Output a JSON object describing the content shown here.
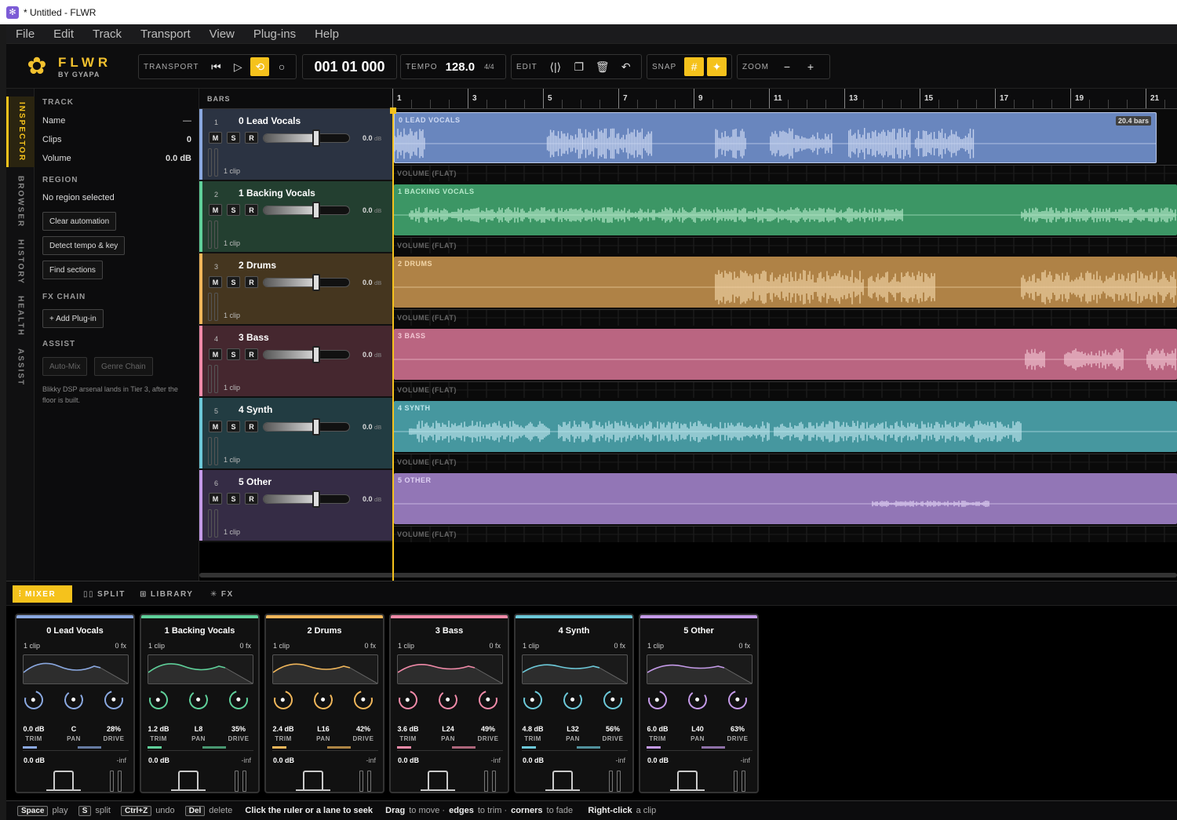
{
  "window": {
    "title": "* Untitled - FLWR"
  },
  "menu": [
    "File",
    "Edit",
    "Track",
    "Transport",
    "View",
    "Plug-ins",
    "Help"
  ],
  "brand": {
    "name": "FLWR",
    "sub": "BY GYAPA",
    "accent": "#f5c21c"
  },
  "toolbar": {
    "transport_label": "TRANSPORT",
    "timecode": "001 01 000",
    "tempo_label": "TEMPO",
    "tempo_value": "128.0",
    "time_sig": "4/4",
    "edit_label": "EDIT",
    "snap_label": "SNAP",
    "zoom_label": "ZOOM"
  },
  "vtabs": [
    "INSPECTOR",
    "BROWSER",
    "HISTORY",
    "HEALTH",
    "ASSIST"
  ],
  "inspector": {
    "track_header": "TRACK",
    "name_label": "Name",
    "name_value": "—",
    "clips_label": "Clips",
    "clips_value": "0",
    "volume_label": "Volume",
    "volume_value": "0.0 dB",
    "region_header": "REGION",
    "region_text": "No region selected",
    "btn_clear": "Clear automation",
    "btn_detect": "Detect tempo & key",
    "btn_find": "Find sections",
    "fx_header": "FX CHAIN",
    "btn_add_plugin": "+ Add Plug-in",
    "assist_header": "ASSIST",
    "btn_automix": "Auto-Mix",
    "btn_genre": "Genre Chain",
    "note": "Blikky DSP arsenal lands in Tier 3, after the floor is built."
  },
  "timeline": {
    "bars_label": "BARS",
    "ruler": [
      "1",
      "3",
      "5",
      "7",
      "9",
      "11",
      "13",
      "15",
      "17",
      "19",
      "21"
    ],
    "automation_label": "VOLUME (FLAT)",
    "clip_length": "20.4 bars"
  },
  "tracks": [
    {
      "num": "1",
      "name": "0 Lead Vocals",
      "lane_name": "0 LEAD VOCALS",
      "db": "0.0",
      "clips": "1 clip",
      "color": "#8aa8e0",
      "hdr": "#2b3342",
      "lane": "#6f8dc8",
      "wave": "#d8e4ff"
    },
    {
      "num": "2",
      "name": "1 Backing Vocals",
      "lane_name": "1 BACKING VOCALS",
      "db": "0.0",
      "clips": "1 clip",
      "color": "#5fd09a",
      "hdr": "#233f30",
      "lane": "#3f9e6a",
      "wave": "#bff5d4"
    },
    {
      "num": "3",
      "name": "2 Drums",
      "lane_name": "2 DRUMS",
      "db": "0.0",
      "clips": "1 clip",
      "color": "#f0b65a",
      "hdr": "#45361f",
      "lane": "#b8894a",
      "wave": "#ffe0b0"
    },
    {
      "num": "4",
      "name": "3 Bass",
      "lane_name": "3 BASS",
      "db": "0.0",
      "clips": "1 clip",
      "color": "#f08aa8",
      "hdr": "#45272f",
      "lane": "#c46a88",
      "wave": "#ffd0dd"
    },
    {
      "num": "5",
      "name": "4 Synth",
      "lane_name": "4 SYNTH",
      "db": "0.0",
      "clips": "1 clip",
      "color": "#6cc8d8",
      "hdr": "#223c42",
      "lane": "#4a9fa8",
      "wave": "#c8f2f8"
    },
    {
      "num": "6",
      "name": "5 Other",
      "lane_name": "5 OTHER",
      "db": "0.0",
      "clips": "1 clip",
      "color": "#c49ae8",
      "hdr": "#352c45",
      "lane": "#9a7cc0",
      "wave": "#eadbff"
    }
  ],
  "db_unit": "dB",
  "bottom_tabs": [
    "MIXER",
    "SPLIT",
    "LIBRARY",
    "FX"
  ],
  "mixer": {
    "fx": "0 fx",
    "trim_label": "TRIM",
    "pan_label": "PAN",
    "drive_label": "DRIVE",
    "strips": [
      {
        "name": "0 Lead Vocals",
        "clips": "1 clip",
        "trim": "0.0 dB",
        "pan": "C",
        "drive": "28%",
        "out": "0.0 dB",
        "inf": "-inf",
        "color": "#8aa8e0"
      },
      {
        "name": "1 Backing Vocals",
        "clips": "1 clip",
        "trim": "1.2 dB",
        "pan": "L8",
        "drive": "35%",
        "out": "0.0 dB",
        "inf": "-inf",
        "color": "#5fd09a"
      },
      {
        "name": "2 Drums",
        "clips": "1 clip",
        "trim": "2.4 dB",
        "pan": "L16",
        "drive": "42%",
        "out": "0.0 dB",
        "inf": "-inf",
        "color": "#f0b65a"
      },
      {
        "name": "3 Bass",
        "clips": "1 clip",
        "trim": "3.6 dB",
        "pan": "L24",
        "drive": "49%",
        "out": "0.0 dB",
        "inf": "-inf",
        "color": "#f08aa8"
      },
      {
        "name": "4 Synth",
        "clips": "1 clip",
        "trim": "4.8 dB",
        "pan": "L32",
        "drive": "56%",
        "out": "0.0 dB",
        "inf": "-inf",
        "color": "#6cc8d8"
      },
      {
        "name": "5 Other",
        "clips": "1 clip",
        "trim": "6.0 dB",
        "pan": "L40",
        "drive": "63%",
        "out": "0.0 dB",
        "inf": "-inf",
        "color": "#c49ae8"
      }
    ]
  },
  "status": {
    "k_space": "Space",
    "t_play": "play",
    "k_s": "S",
    "t_split": "split",
    "k_ctrlz": "Ctrl+Z",
    "t_undo": "undo",
    "k_del": "Del",
    "t_delete": "delete",
    "b_click": "Click the ruler or a lane to seek",
    "b_drag": "Drag",
    "t_move": "to move ·",
    "b_edges": "edges",
    "t_trim": "to trim ·",
    "b_corners": "corners",
    "t_fade": "to fade",
    "b_right": "Right-click",
    "t_clip": "a clip"
  }
}
